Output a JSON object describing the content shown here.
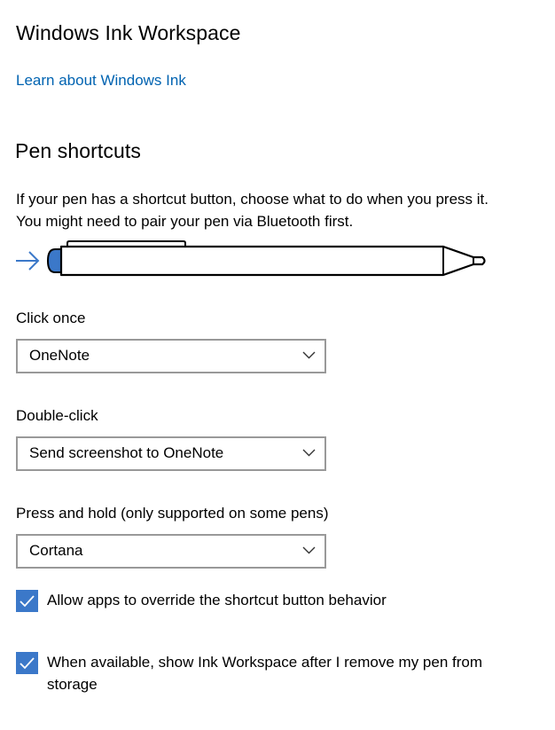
{
  "ink": {
    "title": "Windows Ink Workspace",
    "learn_link": "Learn about Windows Ink"
  },
  "pen": {
    "title": "Pen shortcuts",
    "description": "If your pen has a shortcut button, choose what to do when you press it. You might need to pair your pen via Bluetooth first.",
    "accent_color": "#3b78c9"
  },
  "shortcuts": {
    "click_once": {
      "label": "Click once",
      "value": "OneNote"
    },
    "double_click": {
      "label": "Double-click",
      "value": "Send screenshot to OneNote"
    },
    "press_hold": {
      "label": "Press and hold (only supported on some pens)",
      "value": "Cortana"
    }
  },
  "options": {
    "override": {
      "label": "Allow apps to override the shortcut button behavior",
      "checked": true
    },
    "show_workspace": {
      "label": "When available, show Ink Workspace after I remove my pen from storage",
      "checked": true
    }
  }
}
